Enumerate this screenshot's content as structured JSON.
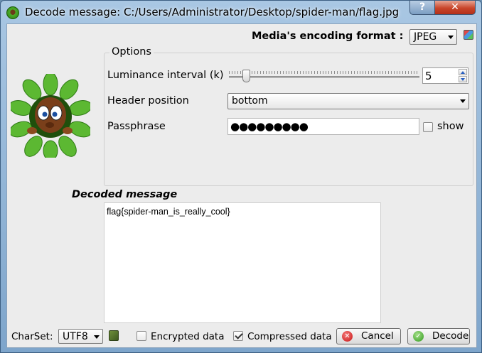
{
  "window": {
    "title": "Decode message: C:/Users/Administrator/Desktop/spider-man/flag.jpg",
    "help_glyph": "?",
    "close_glyph": "✕"
  },
  "encoding": {
    "label": "Media's encoding format :",
    "value": "JPEG"
  },
  "options": {
    "title": "Options",
    "luminance_label": "Luminance interval (k)",
    "luminance_value": "5",
    "header_label": "Header position",
    "header_value": "bottom",
    "passphrase_label": "Passphrase",
    "passphrase_value": "●●●●●●●●●",
    "show_label": "show",
    "show_checked": false
  },
  "decoded": {
    "label": "Decoded message",
    "text": "flag{spider-man_is_really_cool}"
  },
  "bottom": {
    "charset_label": "CharSet:",
    "charset_value": "UTF8",
    "encrypted_label": "Encrypted data",
    "encrypted_checked": false,
    "compressed_label": "Compressed data",
    "compressed_checked": true,
    "cancel_label": "Cancel",
    "decode_label": "Decode"
  }
}
